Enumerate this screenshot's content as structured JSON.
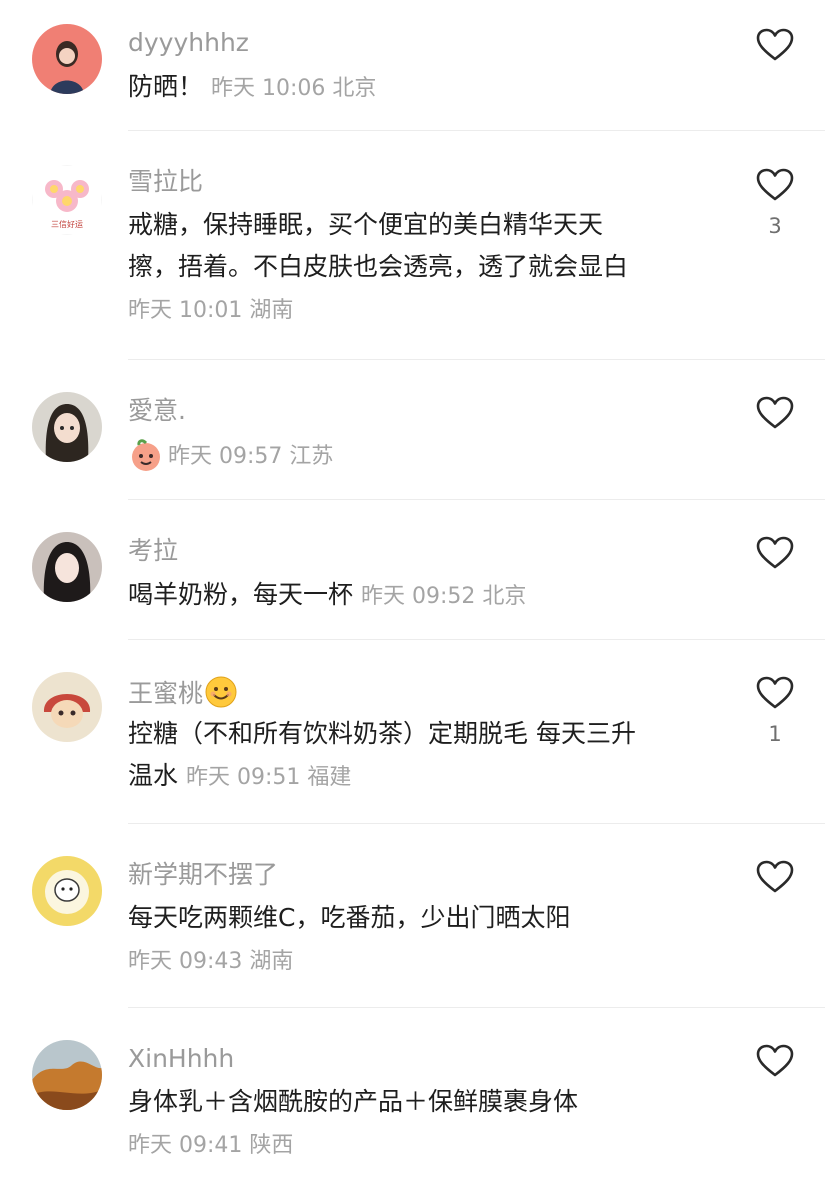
{
  "comments": [
    {
      "username": "dyyyhhhz",
      "text": "防晒！",
      "time": "昨天 10:06",
      "location": "北京",
      "likes": ""
    },
    {
      "username": "雪拉比",
      "text_line1": "戒糖，保持睡眠，买个便宜的美白精华天天",
      "text_line2": "擦，捂着。不白皮肤也会透亮，透了就会显白",
      "time": "昨天 10:01",
      "location": "湖南",
      "likes": "3",
      "avatar_caption": "三信好运"
    },
    {
      "username": "愛意.",
      "text": "",
      "time": "昨天 09:57",
      "location": "江苏",
      "likes": ""
    },
    {
      "username": "考拉",
      "text": "喝羊奶粉，每天一杯",
      "time": "昨天 09:52",
      "location": "北京",
      "likes": ""
    },
    {
      "username": "王蜜桃",
      "text_line1": "控糖（不和所有饮料奶茶）定期脱毛 每天三升",
      "text_line2": "温水",
      "time": "昨天 09:51",
      "location": "福建",
      "likes": "1"
    },
    {
      "username": "新学期不摆了",
      "text": "每天吃两颗维C，吃番茄，少出门晒太阳",
      "time": "昨天 09:43",
      "location": "湖南",
      "likes": ""
    },
    {
      "username": "XinHhhh",
      "text": "身体乳＋含烟酰胺的产品＋保鲜膜裹身体",
      "time": "昨天 09:41",
      "location": "陕西",
      "likes": ""
    }
  ],
  "icons": {
    "like": "heart-outline-icon",
    "emoji": "smiley-emoji-icon",
    "sticker": "peach-sticker-icon"
  },
  "colors": {
    "username": "#9a9a9a",
    "text": "#1e1e1e",
    "meta": "#a4a4a4",
    "divider": "#ececec"
  }
}
